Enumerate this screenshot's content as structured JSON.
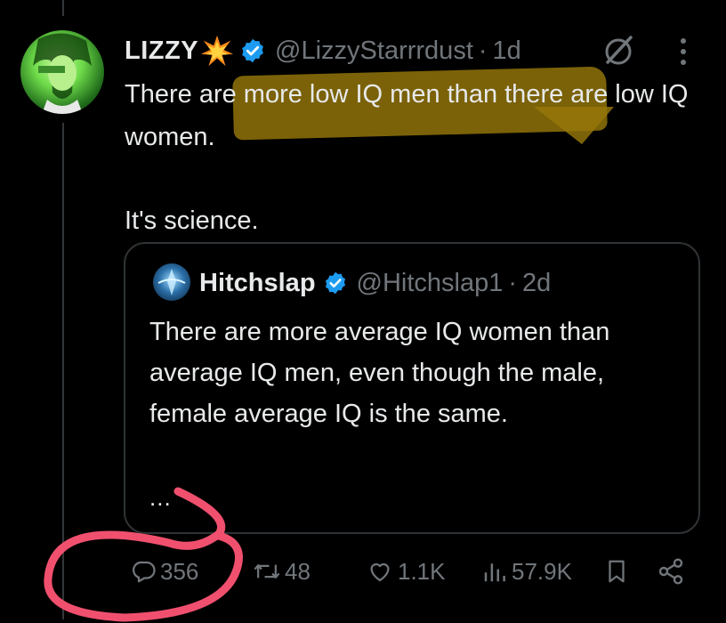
{
  "tweet": {
    "display_name": "LIZZY",
    "handle": "@LizzyStarrrdust",
    "separator": "·",
    "time": "1d",
    "text_line1": "There are more low IQ men than there are low IQ women.",
    "text_line2": "It's science."
  },
  "quote": {
    "display_name": "Hitchslap",
    "handle": "@Hitchslap1",
    "separator": "·",
    "time": "2d",
    "text": "There are more average IQ women than average IQ men, even though the male, female average IQ is the same.",
    "ellipsis": "..."
  },
  "actions": {
    "replies": "356",
    "reposts": "48",
    "likes": "1.1K",
    "views": "57.9K"
  },
  "colors": {
    "background": "#000000",
    "text": "#e7e9ea",
    "muted": "#71767b",
    "verified": "#1d9bf0",
    "highlight": "#96780a",
    "annotation_circle": "#f0506e"
  },
  "icons": [
    "sparkle-emoji",
    "verified-badge-icon",
    "grok-icon",
    "more-icon",
    "reply-icon",
    "repost-icon",
    "like-icon",
    "views-icon",
    "bookmark-icon",
    "share-icon"
  ]
}
